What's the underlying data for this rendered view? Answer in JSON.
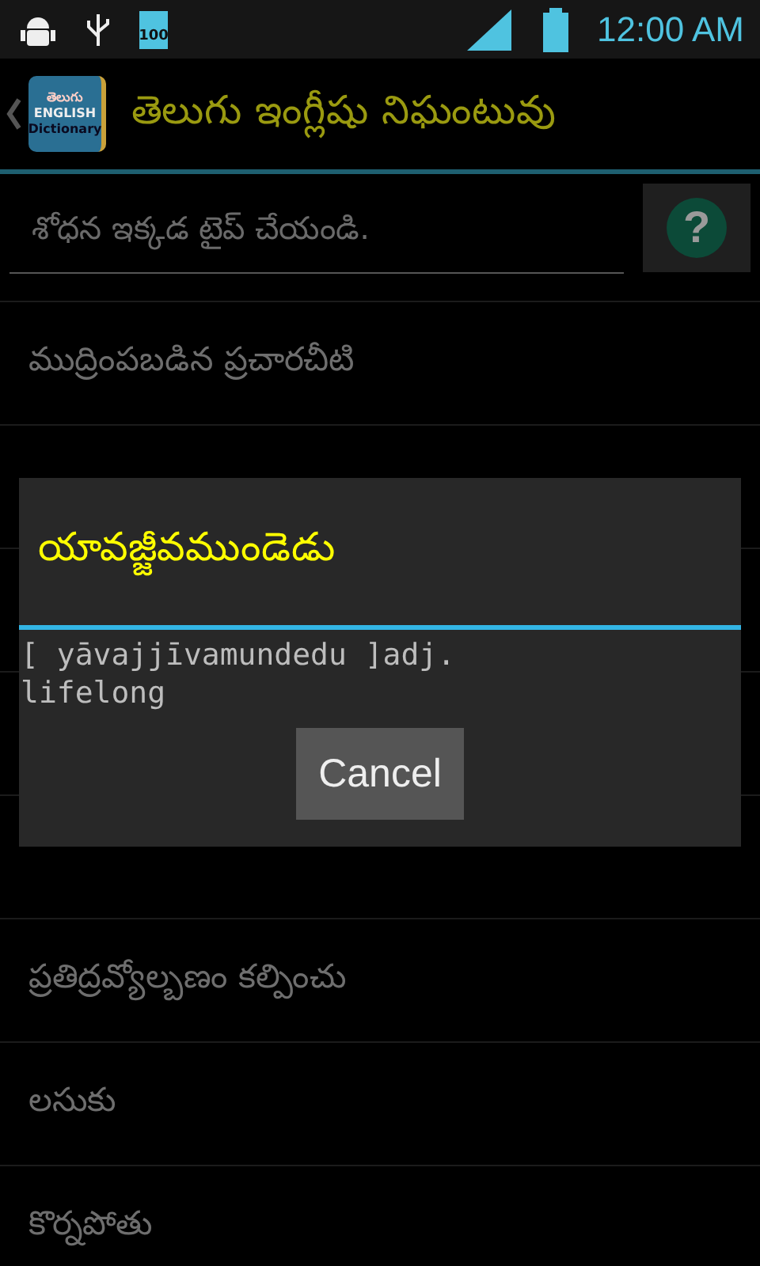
{
  "status_bar": {
    "battery_text": "100",
    "time": "12:00 AM"
  },
  "action_bar": {
    "title": "తెలుగు ఇంగ్లీషు నిఘంటువు",
    "logo_lines": [
      "తెలుగు",
      "ENGLISH",
      "Dictionary"
    ]
  },
  "search": {
    "placeholder": "శోధన ఇక్కడ టైప్ చేయండి.",
    "help_label": "?"
  },
  "list_top": [
    "ముద్రింపబడిన ప్రచారచీటి"
  ],
  "list_bottom": [
    "ప్రతిద్రవ్యోల్బణం కల్పించు",
    "లసుకు",
    "కొర్నపోతు"
  ],
  "dialog": {
    "title": "యావజ్జీవముండెడు",
    "message": "[ yāvajjīvamundedu ]adj.\nlifelong",
    "button": "Cancel"
  }
}
